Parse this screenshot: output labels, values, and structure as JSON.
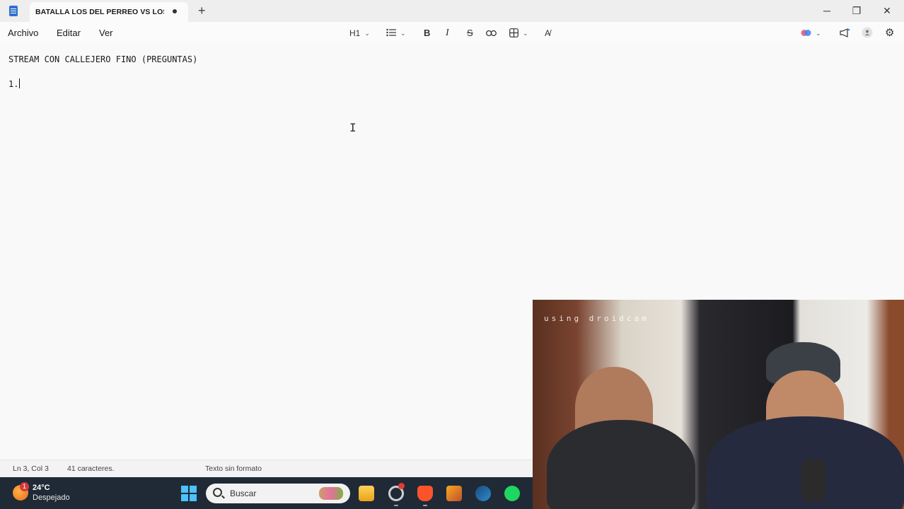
{
  "window": {
    "tab_title": "BATALLA LOS DEL PERREO VS LOS A",
    "new_tab": "+",
    "minimize": "─",
    "maximize": "❐",
    "close": "✕"
  },
  "menu": {
    "file": "Archivo",
    "edit": "Editar",
    "view": "Ver"
  },
  "toolbar": {
    "heading": "H1",
    "bold": "B",
    "italic": "I",
    "strike": "S"
  },
  "document": {
    "lines": [
      "STREAM CON CALLEJERO FINO (PREGUNTAS)",
      "1."
    ]
  },
  "status": {
    "position": "Ln 3, Col 3",
    "characters": "41 caracteres.",
    "format": "Texto sin formato"
  },
  "taskbar": {
    "weather_badge": "1",
    "temperature": "24°C",
    "weather": "Despejado",
    "search_placeholder": "Buscar"
  },
  "webcam": {
    "watermark": "using droidcam"
  },
  "colors": {
    "accent": "#2f6fd0",
    "taskbar": "#1f2a36"
  }
}
